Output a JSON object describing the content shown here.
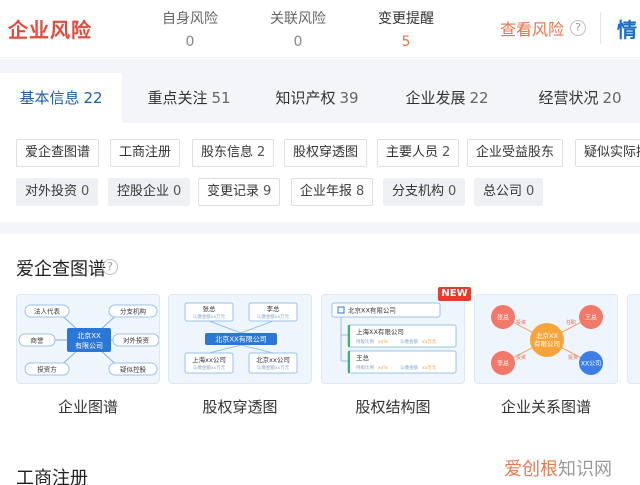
{
  "risk": {
    "title": "企业风险",
    "stats": [
      {
        "label": "自身风险",
        "count": "0"
      },
      {
        "label": "关联风险",
        "count": "0"
      },
      {
        "label": "变更提醒",
        "count": "5"
      }
    ],
    "view_label": "查看风险",
    "right_label": "情"
  },
  "tabs": [
    {
      "label": "基本信息",
      "count": "22"
    },
    {
      "label": "重点关注",
      "count": "51"
    },
    {
      "label": "知识产权",
      "count": "39"
    },
    {
      "label": "企业发展",
      "count": "22"
    },
    {
      "label": "经营状况",
      "count": "20"
    }
  ],
  "chips": [
    {
      "label": "爱企查图谱",
      "count": ""
    },
    {
      "label": "工商注册",
      "count": ""
    },
    {
      "label": "股东信息",
      "count": "2"
    },
    {
      "label": "股权穿透图",
      "count": ""
    },
    {
      "label": "主要人员",
      "count": "2"
    },
    {
      "label": "企业受益股东",
      "count": ""
    },
    {
      "label": "疑似实际控",
      "count": ""
    },
    {
      "label": "对外投资",
      "count": "0"
    },
    {
      "label": "控股企业",
      "count": "0"
    },
    {
      "label": "变更记录",
      "count": "9"
    },
    {
      "label": "企业年报",
      "count": "8"
    },
    {
      "label": "分支机构",
      "count": "0"
    },
    {
      "label": "总公司",
      "count": "0"
    }
  ],
  "section": {
    "title": "爱企查图谱",
    "help": "?",
    "cards": [
      {
        "label": "企业图谱",
        "center": [
          "北京XX",
          "有限公司"
        ],
        "nodes": [
          "法人代表",
          "商誉",
          "投资方",
          "分支机构",
          "对外投资",
          "疑似控股"
        ]
      },
      {
        "label": "股权穿透图",
        "top": [
          {
            "name": "张总",
            "sub": "认缴金额xx万元"
          },
          {
            "name": "李总",
            "sub": "认缴金额xx万元"
          }
        ],
        "center": "北京XX有限公司",
        "bottom": [
          {
            "name": "上海xx公司",
            "sub": "认缴金额xx万元"
          },
          {
            "name": "北京xx公司",
            "sub": "认缴金额xx万元"
          }
        ]
      },
      {
        "label": "股权结构图",
        "badge": "NEW",
        "root": "北京XX有限公司",
        "rows": [
          {
            "name": "上海XX有限公司",
            "meta": [
              "持股比例",
              "xx%",
              "认缴金额",
              "xx万元"
            ]
          },
          {
            "name": "王总",
            "meta": [
              "持股比例",
              "xx%",
              "认缴金额",
              "xx万元"
            ]
          }
        ]
      },
      {
        "label": "企业关系图谱",
        "center": [
          "北京XX",
          "有限公司"
        ],
        "nodes": [
          "张总",
          "王总",
          "李总",
          "XX公司"
        ],
        "edges": [
          "投资",
          "任职",
          "投资",
          "投资"
        ]
      }
    ]
  },
  "next_section": {
    "title": "工商注册"
  },
  "watermark": {
    "part1": "爱创根",
    "part2": "知识网"
  },
  "colors": {
    "accent_blue": "#1a5fb4",
    "risk_red": "#e24a3b",
    "warn_orange": "#e7734a",
    "node_red": "#f2786a",
    "node_orange": "#f7a43b",
    "node_blue": "#3d7ee6"
  }
}
